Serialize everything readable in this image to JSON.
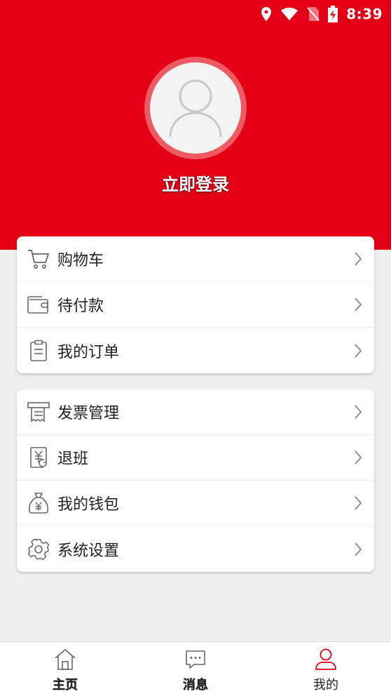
{
  "status_bar": {
    "time": "8:39"
  },
  "header": {
    "login_label": "立即登录",
    "accent": "#e30016"
  },
  "menu_group_1": [
    {
      "label": "购物车",
      "icon": "cart-icon"
    },
    {
      "label": "待付款",
      "icon": "wallet-icon"
    },
    {
      "label": "我的订单",
      "icon": "clipboard-icon"
    }
  ],
  "menu_group_2": [
    {
      "label": "发票管理",
      "icon": "receipt-icon"
    },
    {
      "label": "退班",
      "icon": "refund-icon"
    },
    {
      "label": "我的钱包",
      "icon": "money-bag-icon"
    },
    {
      "label": "系统设置",
      "icon": "gear-icon"
    }
  ],
  "tabbar": {
    "tabs": [
      {
        "label": "主页",
        "icon": "home-icon",
        "active": false
      },
      {
        "label": "消息",
        "icon": "message-icon",
        "active": false
      },
      {
        "label": "我的",
        "icon": "user-icon",
        "active": true
      }
    ],
    "active_color": "#e30016"
  }
}
